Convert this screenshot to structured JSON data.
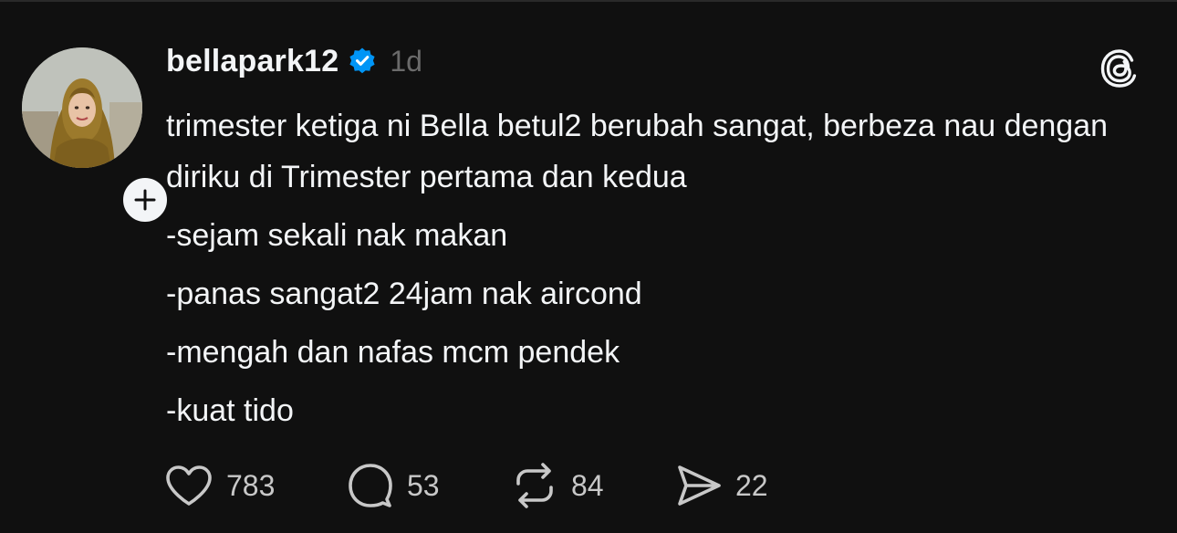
{
  "post": {
    "username": "bellapark12",
    "verified_icon": "verified-badge-icon",
    "time_ago": "1d",
    "text_lines": [
      "trimester ketiga ni Bella betul2 berubah sangat, berbeza nau dengan diriku di Trimester pertama dan kedua",
      "-sejam sekali nak makan",
      "-panas sangat2 24jam nak aircond",
      "-mengah dan nafas mcm pendek",
      "-kuat tido"
    ]
  },
  "actions": {
    "likes": "783",
    "replies": "53",
    "reposts": "84",
    "shares": "22"
  },
  "colors": {
    "background": "#101010",
    "text": "#f3f5f7",
    "muted": "#6b6b6b",
    "verified": "#0095f6"
  }
}
